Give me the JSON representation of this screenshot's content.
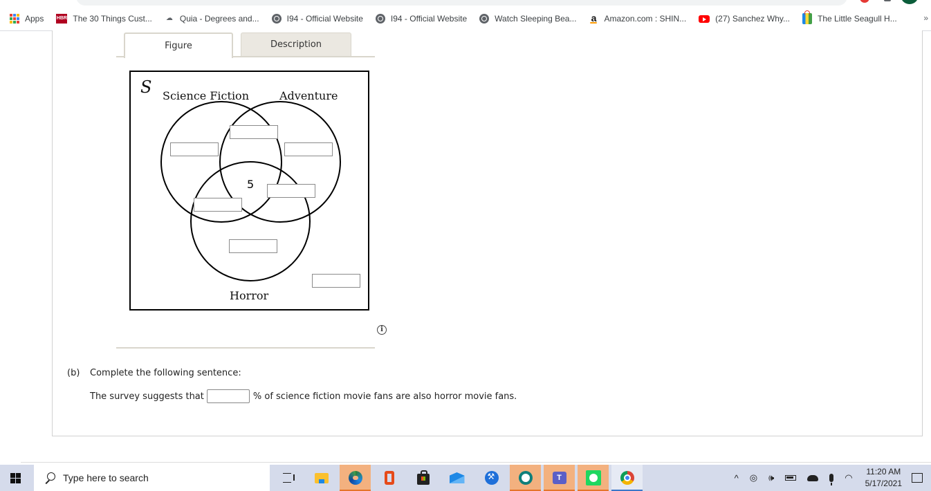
{
  "browser": {
    "bookmarks": [
      {
        "label": "Apps",
        "icon": "apps-grid-icon"
      },
      {
        "label": "The 30 Things Cust...",
        "icon": "hbr-icon"
      },
      {
        "label": "Quia - Degrees and...",
        "icon": "quia-icon"
      },
      {
        "label": "I94 - Official Website",
        "icon": "globe-icon"
      },
      {
        "label": "I94 - Official Website",
        "icon": "globe-icon"
      },
      {
        "label": "Watch Sleeping Bea...",
        "icon": "globe-icon"
      },
      {
        "label": "Amazon.com : SHIN...",
        "icon": "amazon-icon"
      },
      {
        "label": "(27) Sanchez Why...",
        "icon": "youtube-icon"
      },
      {
        "label": "The Little Seagull H...",
        "icon": "shopping-bag-icon"
      }
    ],
    "more_label": "»"
  },
  "figure": {
    "tabs": [
      {
        "label": "Figure",
        "selected": true
      },
      {
        "label": "Description",
        "selected": false
      }
    ],
    "venn": {
      "universe_label": "S",
      "sets": [
        "Science Fiction",
        "Adventure",
        "Horror"
      ],
      "center_value": "5",
      "regions": [
        {
          "region": "sci-fi-and-adventure-only",
          "value": ""
        },
        {
          "region": "sci-fi-only",
          "value": ""
        },
        {
          "region": "adventure-only",
          "value": ""
        },
        {
          "region": "adventure-and-horror-only",
          "value": ""
        },
        {
          "region": "sci-fi-and-horror-only",
          "value": ""
        },
        {
          "region": "horror-only",
          "value": ""
        },
        {
          "region": "outside-all",
          "value": ""
        }
      ]
    },
    "info_icon": "i"
  },
  "question": {
    "part_label": "(b)",
    "prompt": "Complete the following sentence:",
    "sentence_before": "The survey suggests that",
    "answer_value": "",
    "sentence_after": "% of science fiction movie fans are also horror movie fans."
  },
  "taskbar": {
    "search_placeholder": "Type here to search",
    "apps": [
      "task-view",
      "file-explorer",
      "edge",
      "office",
      "microsoft-store",
      "mail",
      "tool-app",
      "circle-app",
      "teams",
      "spotify",
      "chrome"
    ],
    "clock_time": "11:20 AM",
    "clock_date": "5/17/2021",
    "tray_caret": "^"
  }
}
